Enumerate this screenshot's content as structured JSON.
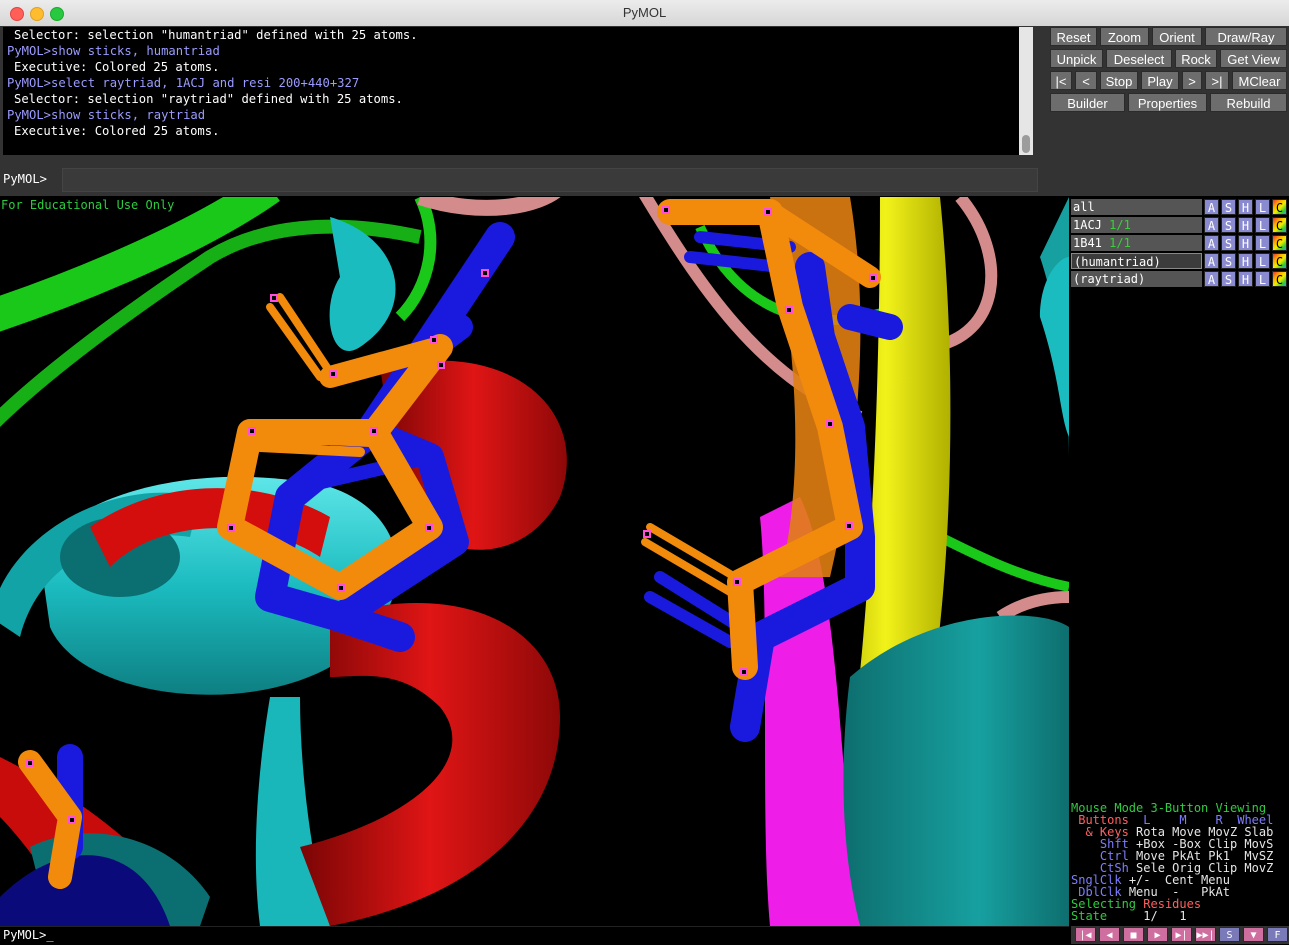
{
  "window": {
    "title": "PyMOL"
  },
  "console": {
    "lines": [
      {
        "kind": "out",
        "text": "Selector: selection \"humantriad\" defined with 25 atoms."
      },
      {
        "kind": "cmd",
        "text": "PyMOL>show sticks, humantriad"
      },
      {
        "kind": "out",
        "text": "Executive: Colored 25 atoms."
      },
      {
        "kind": "cmd",
        "text": "PyMOL>select raytriad, 1ACJ and resi 200+440+327"
      },
      {
        "kind": "out",
        "text": "Selector: selection \"raytriad\" defined with 25 atoms."
      },
      {
        "kind": "cmd",
        "text": "PyMOL>show sticks, raytriad"
      },
      {
        "kind": "out",
        "text": "Executive: Colored 25 atoms."
      }
    ],
    "prompt_label": "PyMOL>",
    "input_value": ""
  },
  "buttons": {
    "row1": [
      "Reset",
      "Zoom",
      "Orient",
      "Draw/Ray"
    ],
    "row2": [
      "Unpick",
      "Deselect",
      "Rock",
      "Get View"
    ],
    "row3": [
      "|<",
      "<",
      "Stop",
      "Play",
      ">",
      ">|",
      "MClear"
    ],
    "row4": [
      "Builder",
      "Properties",
      "Rebuild"
    ]
  },
  "viewport": {
    "overlay_text": "For Educational Use Only"
  },
  "objects": [
    {
      "name": "all",
      "state": ""
    },
    {
      "name": "1ACJ",
      "state": "1/1"
    },
    {
      "name": "1B41",
      "state": "1/1"
    },
    {
      "name": "(humantriad)",
      "state": ""
    },
    {
      "name": "(raytriad)",
      "state": ""
    }
  ],
  "object_buttons": [
    "A",
    "S",
    "H",
    "L",
    "C"
  ],
  "mouse_info": {
    "line1_a": "Mouse Mode",
    "line1_b": "3-Button Viewing",
    "line2_a": "Buttons",
    "line2_l": "L",
    "line2_m": "M",
    "line2_r": "R",
    "line2_w": "Wheel",
    "line3_a": "& Keys",
    "line3_b": "Rota Move MovZ Slab",
    "line4_a": "Shft",
    "line4_b": "+Box -Box Clip MovS",
    "line5_a": "Ctrl",
    "line5_b": "Move PkAt Pk1  MvSZ",
    "line6_a": "CtSh",
    "line6_b": "Sele Orig Clip MovZ",
    "line7_a": "SnglClk",
    "line7_b": "+/-  Cent Menu",
    "line8_a": "DblClk",
    "line8_b": "Menu  -   PkAt",
    "line9_a": "Selecting",
    "line9_b": "Residues",
    "line10_a": "State",
    "line10_b": "1/",
    "line10_c": "1"
  },
  "bottom": {
    "prompt": "PyMOL>_"
  },
  "movie_controls": [
    "|◀",
    "◀",
    "■",
    "▶",
    "▶|",
    "▶▶|",
    "S",
    "▼",
    "F"
  ],
  "colors": {
    "human_sticks": "#f28a0c",
    "ray_sticks": "#1a1adf",
    "cartoon_cyan": "#1bbcc0",
    "cartoon_red": "#d40d0d",
    "cartoon_green": "#19d019",
    "cartoon_salmon": "#d38b8b",
    "cartoon_yellow": "#e8e80e",
    "cartoon_magenta": "#ee1ee8",
    "cartoon_teal": "#148a8a"
  }
}
